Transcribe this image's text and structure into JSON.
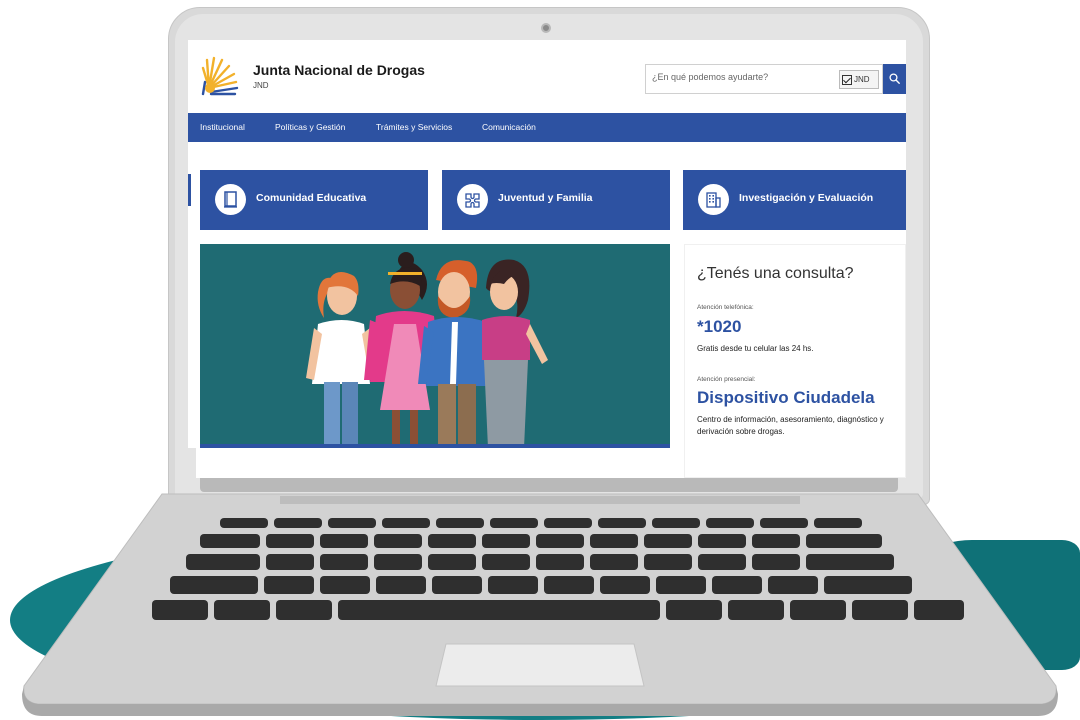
{
  "header": {
    "title": "Junta Nacional de Drogas",
    "subtitle": "JND"
  },
  "search": {
    "placeholder": "¿En qué podemos ayudarte?",
    "filter_label": "JND",
    "filter_checked": true
  },
  "nav": {
    "items": [
      {
        "label": "Institucional"
      },
      {
        "label": "Políticas y Gestión"
      },
      {
        "label": "Trámites y Servicios"
      },
      {
        "label": "Comunicación"
      }
    ]
  },
  "quick_links": [
    {
      "label": "Comunidad Educativa",
      "icon": "book-icon"
    },
    {
      "label": "Juventud y Familia",
      "icon": "people-puzzle-icon"
    },
    {
      "label": "Investigación y Evaluación",
      "icon": "building-icon"
    }
  ],
  "contact": {
    "title": "¿Tenés una consulta?",
    "phone_label": "Atención telefónica:",
    "phone": "*1020",
    "phone_note": "Gratis desde tu celular las 24 hs.",
    "inperson_label": "Atención presencial:",
    "place": "Dispositivo Ciudadela",
    "place_note": "Centro de información, asesoramiento, diagnóstico y derivación sobre drogas."
  },
  "colors": {
    "brand_blue": "#2d52a2",
    "hero_teal": "#1f6b73",
    "backdrop_teal": "#137e84"
  }
}
